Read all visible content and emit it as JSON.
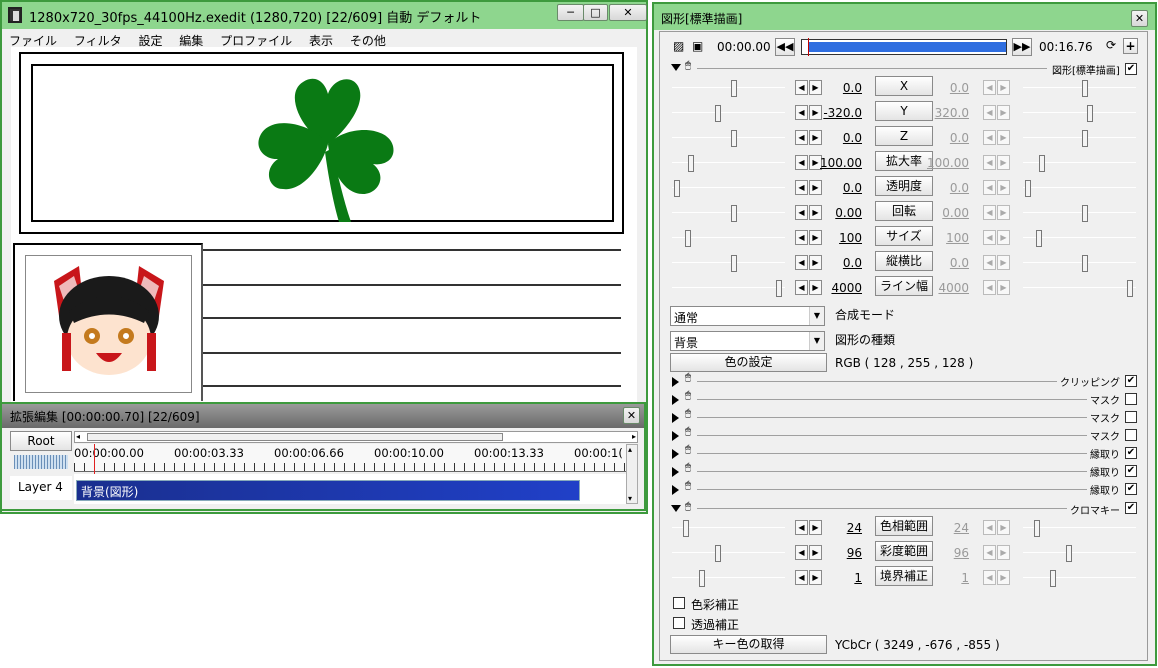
{
  "main_window": {
    "title": "1280x720_30fps_44100Hz.exedit (1280,720)  [22/609]  自動  デフォルト",
    "menu": [
      "ファイル",
      "フィルタ",
      "設定",
      "編集",
      "プロファイル",
      "表示",
      "その他"
    ],
    "min_glyph": "─",
    "max_glyph": "□",
    "close_glyph": "✕"
  },
  "timeline_window": {
    "title": "拡張編集 [00:00:00.70] [22/609]",
    "root_label": "Root",
    "layer_label": "Layer  4",
    "time_marks": [
      "00:00:00.00",
      "00:00:03.33",
      "00:00:06.66",
      "00:00:10.00",
      "00:00:13.33",
      "00:00:1("
    ],
    "clip_label": "背景(図形)",
    "close_glyph": "✕"
  },
  "props_window": {
    "title": "図形[標準描画]",
    "close_glyph": "✕",
    "time_start": "00:00.00",
    "time_end": "00:16.76",
    "playback_fraction": 0.03,
    "header_label": "図形[標準描画]",
    "header_checked": true,
    "params": [
      {
        "name": "X",
        "left": "0.0",
        "right": "0.0",
        "sl": 0.55,
        "sr": 0.55
      },
      {
        "name": "Y",
        "left": "-320.0",
        "right": "320.0",
        "sl": 0.4,
        "sr": 0.6
      },
      {
        "name": "Z",
        "left": "0.0",
        "right": "0.0",
        "sl": 0.55,
        "sr": 0.55
      },
      {
        "name": "拡大率",
        "left": "100.00",
        "right": "100.00",
        "sl": 0.15,
        "sr": 0.15
      },
      {
        "name": "透明度",
        "left": "0.0",
        "right": "0.0",
        "sl": 0.02,
        "sr": 0.02
      },
      {
        "name": "回転",
        "left": "0.00",
        "right": "0.00",
        "sl": 0.55,
        "sr": 0.55
      },
      {
        "name": "サイズ",
        "left": "100",
        "right": "100",
        "sl": 0.12,
        "sr": 0.12
      },
      {
        "name": "縦横比",
        "left": "0.0",
        "right": "0.0",
        "sl": 0.55,
        "sr": 0.55
      },
      {
        "name": "ライン幅",
        "left": "4000",
        "right": "4000",
        "sl": 0.97,
        "sr": 0.97
      }
    ],
    "blend_value": "通常",
    "blend_label": "合成モード",
    "shape_value": "背景",
    "shape_label": "図形の種類",
    "color_button": "色の設定",
    "color_value": "RGB ( 128 , 255 , 128 )",
    "filters": [
      {
        "label": "クリッピング",
        "checked": true
      },
      {
        "label": "マスク",
        "checked": false
      },
      {
        "label": "マスク",
        "checked": false
      },
      {
        "label": "マスク",
        "checked": false
      },
      {
        "label": "縁取り",
        "checked": true
      },
      {
        "label": "縁取り",
        "checked": true
      },
      {
        "label": "縁取り",
        "checked": true
      }
    ],
    "chroma_label": "クロマキー",
    "chroma_checked": true,
    "chroma_params": [
      {
        "name": "色相範囲",
        "left": "24",
        "right": "24",
        "sl": 0.1,
        "sr": 0.1
      },
      {
        "name": "彩度範囲",
        "left": "96",
        "right": "96",
        "sl": 0.4,
        "sr": 0.4
      },
      {
        "name": "境界補正",
        "left": "1",
        "right": "1",
        "sl": 0.25,
        "sr": 0.25
      }
    ],
    "color_correct_label": "色彩補正",
    "alpha_correct_label": "透過補正",
    "key_button": "キー色の取得",
    "key_value": "YCbCr ( 3249 , -676 , -855 )"
  }
}
